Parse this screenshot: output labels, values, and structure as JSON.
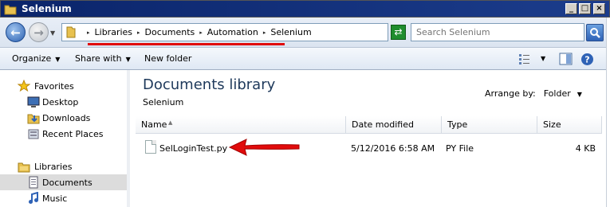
{
  "window": {
    "title": "Selenium"
  },
  "address": {
    "crumbs": [
      "Libraries",
      "Documents",
      "Automation",
      "Selenium"
    ]
  },
  "search": {
    "placeholder": "Search Selenium"
  },
  "toolbar": {
    "organize": "Organize",
    "share_with": "Share with",
    "new_folder": "New folder"
  },
  "sidebar": {
    "items": [
      {
        "label": "Favorites",
        "icon": "star-icon"
      },
      {
        "label": "Desktop",
        "icon": "desktop-icon"
      },
      {
        "label": "Downloads",
        "icon": "downloads-icon"
      },
      {
        "label": "Recent Places",
        "icon": "recent-places-icon"
      },
      {
        "label": "Libraries",
        "icon": "libraries-icon"
      },
      {
        "label": "Documents",
        "icon": "documents-icon",
        "selected": true
      },
      {
        "label": "Music",
        "icon": "music-icon"
      }
    ]
  },
  "library": {
    "title": "Documents library",
    "subtitle": "Selenium",
    "arrange_label": "Arrange by:",
    "arrange_value": "Folder"
  },
  "table": {
    "columns": [
      "Name",
      "Date modified",
      "Type",
      "Size"
    ],
    "rows": [
      {
        "name": "SelLoginTest.py",
        "date": "5/12/2016 6:58 AM",
        "type": "PY File",
        "size": "4 KB"
      }
    ]
  },
  "colors": {
    "annotation": "#e10b0b",
    "title_text": "#1e395b",
    "selected_bg": "#dcdcdc"
  }
}
